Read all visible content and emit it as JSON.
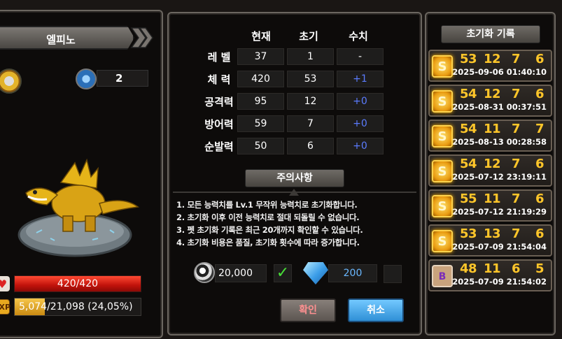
{
  "pet": {
    "name": "엘피노",
    "skill_level": "2",
    "hp": "420/420",
    "hp_ratio": 1.0,
    "exp": "5,074/21,098 (24,05%)",
    "exp_ratio": 0.2405,
    "exp_icon_label": "EXP"
  },
  "stats_table": {
    "headers": [
      "현재",
      "초기",
      "수치"
    ],
    "rows": [
      {
        "label": "레 벨",
        "current": "37",
        "initial": "1",
        "change": "-"
      },
      {
        "label": "체 력",
        "current": "420",
        "initial": "53",
        "change": "+1"
      },
      {
        "label": "공격력",
        "current": "95",
        "initial": "12",
        "change": "+0"
      },
      {
        "label": "방어력",
        "current": "59",
        "initial": "7",
        "change": "+0"
      },
      {
        "label": "순발력",
        "current": "50",
        "initial": "6",
        "change": "+0"
      }
    ]
  },
  "notice": {
    "title": "주의사항",
    "lines": [
      "1. 모든 능력치를 Lv.1 무작위 능력치로 초기화합니다.",
      "2. 초기화 이후 이전 능력치로 절대 되돌릴 수 없습니다.",
      "3. 펫 초기화 기록은 최근 20개까지 확인할 수 있습니다.",
      "4. 초기화 비용은 품질, 초기화 횟수에 따라 증가합니다."
    ]
  },
  "cost": {
    "gold": "20,000",
    "check_mark": "✓",
    "gems": "200"
  },
  "buttons": {
    "confirm": "확인",
    "cancel": "취소"
  },
  "records": {
    "title": "초기화 기록",
    "items": [
      {
        "rank": "S",
        "stats": [
          "53",
          "12",
          "7",
          "6"
        ],
        "time": "2025-09-06 01:40:10"
      },
      {
        "rank": "S",
        "stats": [
          "54",
          "12",
          "7",
          "6"
        ],
        "time": "2025-08-31 00:37:51"
      },
      {
        "rank": "S",
        "stats": [
          "54",
          "11",
          "7",
          "7"
        ],
        "time": "2025-08-13 00:28:58"
      },
      {
        "rank": "S",
        "stats": [
          "54",
          "12",
          "7",
          "6"
        ],
        "time": "2025-07-12 23:19:11"
      },
      {
        "rank": "S",
        "stats": [
          "55",
          "11",
          "7",
          "6"
        ],
        "time": "2025-07-12 21:19:29"
      },
      {
        "rank": "S",
        "stats": [
          "53",
          "13",
          "7",
          "6"
        ],
        "time": "2025-07-09 21:54:04"
      },
      {
        "rank": "B",
        "stats": [
          "48",
          "11",
          "6",
          "5"
        ],
        "time": "2025-07-09 21:54:02"
      }
    ]
  },
  "colors": {
    "accent_gold": "#ffc62a",
    "stat_blue": "#5b7cff",
    "hp_red": "#c1120b",
    "cancel_blue": "#2f8fd6"
  }
}
